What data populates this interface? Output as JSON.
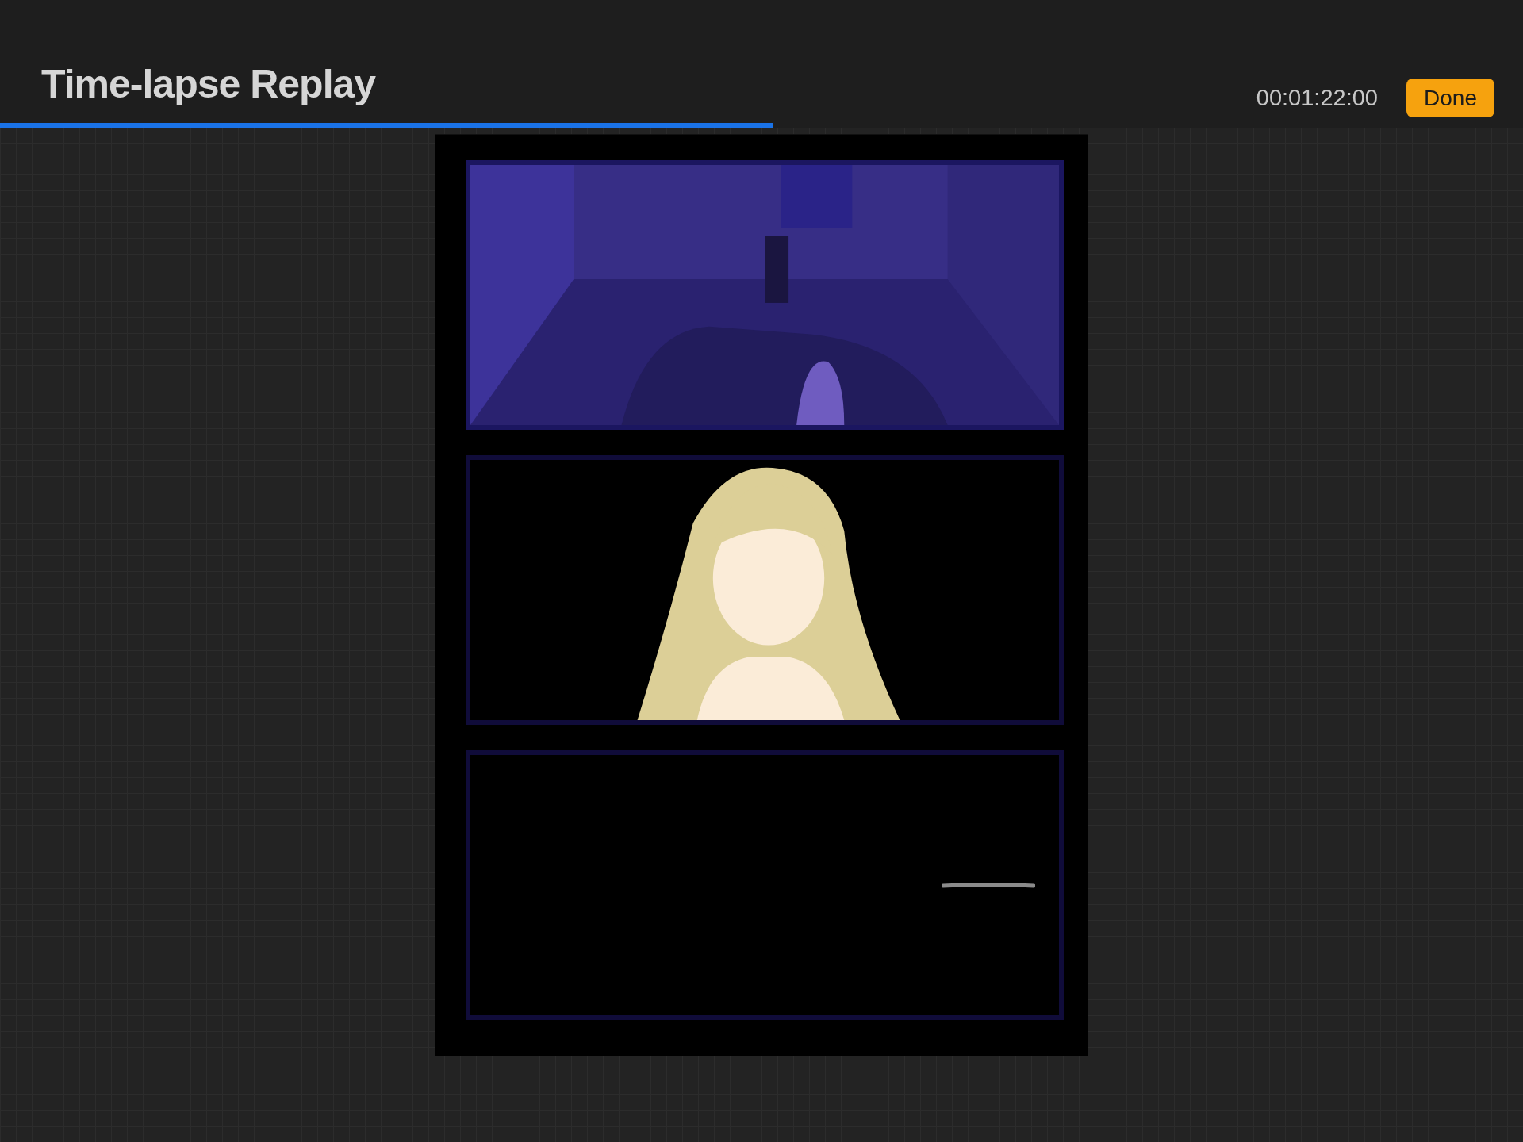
{
  "header": {
    "title": "Time-lapse Replay",
    "timecode": "00:01:22:00",
    "done_button": "Done"
  },
  "playback": {
    "level": 0.508
  }
}
